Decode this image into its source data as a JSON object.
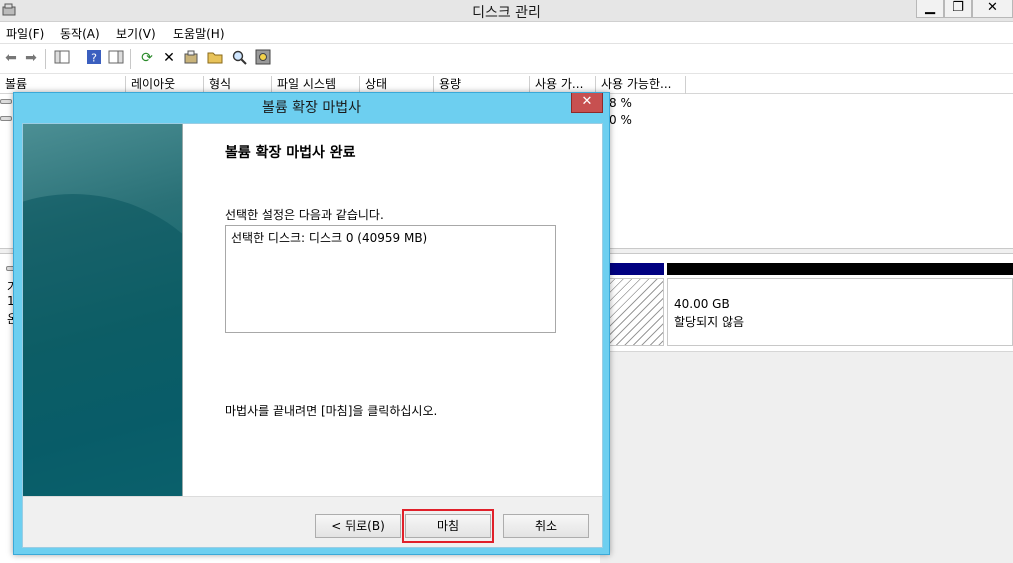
{
  "window": {
    "title": "디스크 관리",
    "controls": {
      "minimize": "▁",
      "maximize": "❐",
      "close": "✕"
    }
  },
  "menu": [
    "파일(F)",
    "동작(A)",
    "보기(V)",
    "도움말(H)"
  ],
  "toolbar_icons": [
    "back-arrow-icon",
    "forward-arrow-icon",
    "console-tree-icon",
    "help-icon",
    "action-pane-icon",
    "refresh-icon",
    "delete-icon",
    "properties-icon",
    "open-folder-icon",
    "search-icon",
    "settings-icon"
  ],
  "volume_list": {
    "columns": [
      "볼륨",
      "레이아웃",
      "형식",
      "파일 시스템",
      "상태",
      "용량",
      "사용 가...",
      "사용 가능한..."
    ],
    "rows": [
      {
        "percent": "8 %"
      },
      {
        "percent": "0 %"
      }
    ]
  },
  "disk_view": {
    "left_fragments": [
      "가",
      "1",
      "온"
    ],
    "unallocated_size": "40.00 GB",
    "unallocated_status": "할당되지 않음",
    "colors": {
      "primary_bar": "#000080",
      "unallocated_bar": "#000000"
    }
  },
  "wizard": {
    "title": "볼륨 확장 마법사",
    "close_label": "✕",
    "heading": "볼륨 확장 마법사 완료",
    "intro": "선택한 설정은 다음과 같습니다.",
    "settings_text": "선택한 디스크: 디스크 0 (40959 MB)",
    "finish_message": "마법사를 끝내려면 [마침]을 클릭하십시오.",
    "buttons": {
      "back": "< 뒤로(B)",
      "finish": "마침",
      "cancel": "취소"
    },
    "colors": {
      "frame": "#6dcff0",
      "highlight": "#e0202a"
    }
  }
}
